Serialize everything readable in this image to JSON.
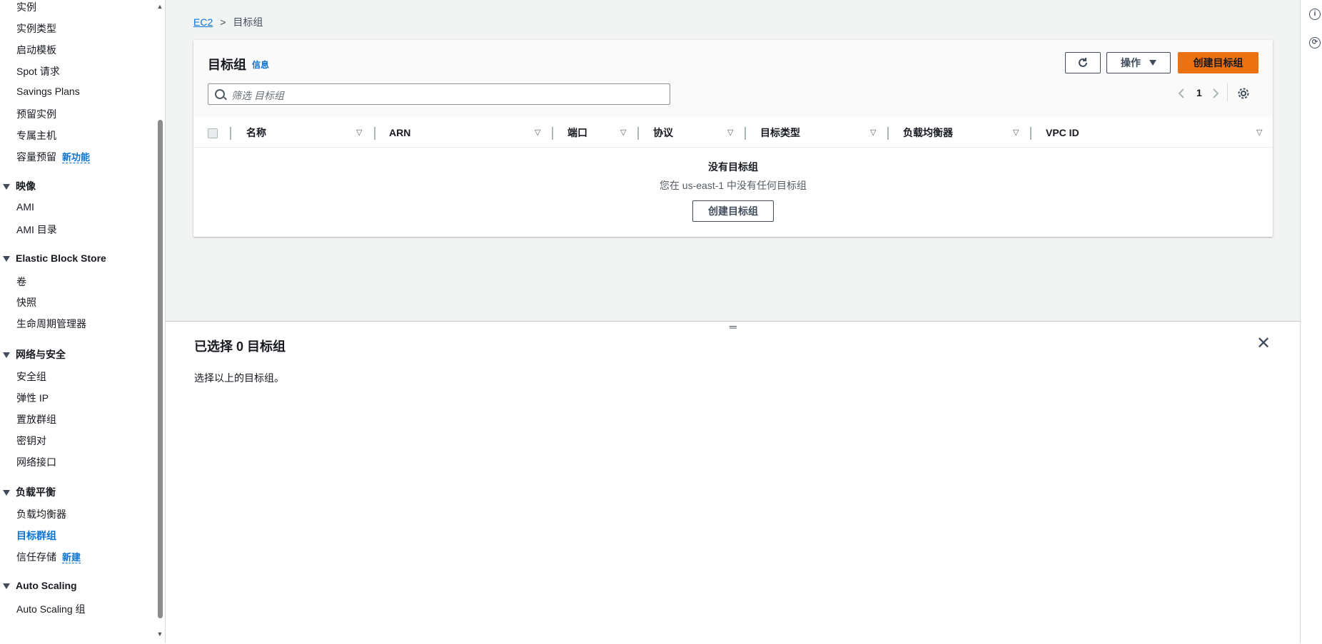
{
  "sidebar": {
    "items_top": [
      "实例",
      "实例类型",
      "启动模板",
      "Spot 请求",
      "Savings Plans",
      "预留实例",
      "专属主机"
    ],
    "capacity": {
      "label": "容量预留",
      "badge": "新功能"
    },
    "sections": {
      "images": {
        "title": "映像",
        "items": [
          "AMI",
          "AMI 目录"
        ]
      },
      "ebs": {
        "title": "Elastic Block Store",
        "items": [
          "卷",
          "快照",
          "生命周期管理器"
        ]
      },
      "network": {
        "title": "网络与安全",
        "items": [
          "安全组",
          "弹性 IP",
          "置放群组",
          "密钥对",
          "网络接口"
        ]
      },
      "lb": {
        "title": "负载平衡",
        "items": [
          "负载均衡器",
          "目标群组"
        ],
        "trust": {
          "label": "信任存储",
          "badge": "新建"
        }
      },
      "asg": {
        "title": "Auto Scaling",
        "items": [
          "Auto Scaling 组"
        ]
      }
    }
  },
  "breadcrumb": {
    "root": "EC2",
    "sep": ">",
    "current": "目标组"
  },
  "panel": {
    "title": "目标组",
    "info": "信息",
    "actions_label": "操作",
    "create_label": "创建目标组",
    "search_placeholder": "筛选 目标组",
    "page_number": "1",
    "columns": [
      "名称",
      "ARN",
      "端口",
      "协议",
      "目标类型",
      "负载均衡器",
      "VPC ID"
    ],
    "empty_title": "没有目标组",
    "empty_subtitle": "您在 us-east-1 中没有任何目标组",
    "empty_create_label": "创建目标组"
  },
  "split": {
    "title": "已选择 0 目标组",
    "hint": "选择以上的目标组。"
  },
  "icons": [
    "refresh-icon",
    "caret-down-icon",
    "search-icon",
    "chevron-left-icon",
    "chevron-right-icon",
    "settings-icon",
    "close-icon",
    "info-icon",
    "feedback-icon"
  ],
  "colors": {
    "primary": "#ec7211",
    "link": "#0972d3",
    "background": "#f2f3f3"
  }
}
